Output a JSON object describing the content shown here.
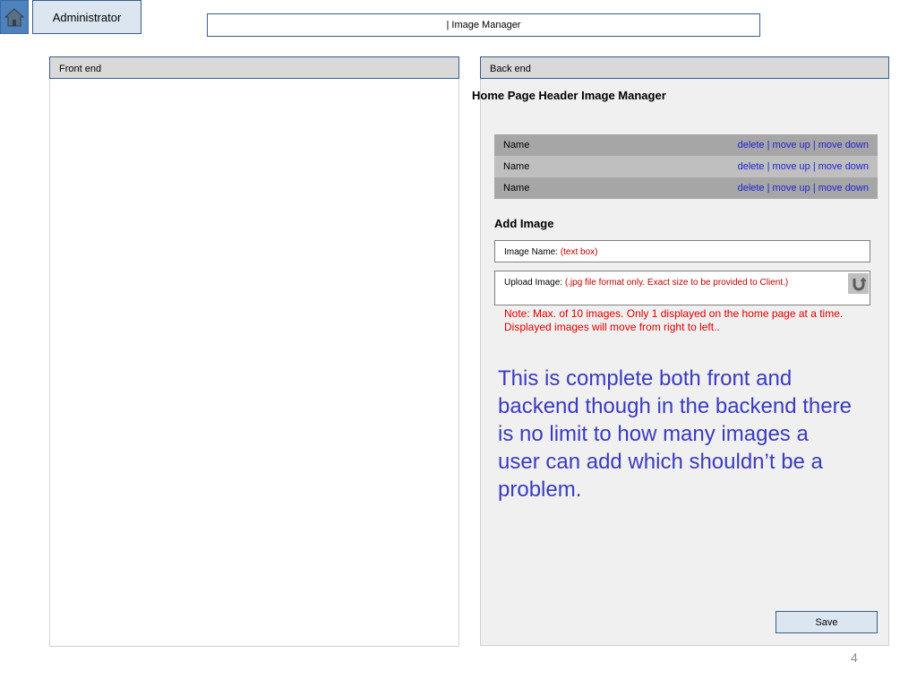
{
  "header": {
    "home_icon": "home-icon",
    "admin_label": "Administrator",
    "title": "| Image Manager"
  },
  "front_end": {
    "heading": "Front end"
  },
  "back_end": {
    "heading": "Back end",
    "section_title": "Home Page Header Image Manager",
    "images": [
      {
        "name": "Name",
        "delete": "delete",
        "move_up": "move up",
        "move_down": "move down"
      },
      {
        "name": "Name",
        "delete": "delete",
        "move_up": "move up",
        "move_down": "move down"
      },
      {
        "name": "Name",
        "delete": "delete",
        "move_up": "move up",
        "move_down": "move down"
      }
    ],
    "separator": "|",
    "add_title": "Add Image",
    "image_name_label": "Image Name:",
    "image_name_hint": "(text box)",
    "upload_label": "Upload Image:",
    "upload_hint": "(.jpg file format only. Exact size to be  provided to Client.)",
    "upload_icon": "upload-icon",
    "note": "Note: Max. of 10 images. Only 1 displayed on the home page at a time. Displayed images will move from right to left..",
    "comment": "This is complete both front and backend though in the backend there is no limit to how many images a user can add which shouldn’t be a problem.",
    "save_label": "Save"
  },
  "page_number": "4",
  "colors": {
    "accent": "#385d8a",
    "link": "#1f1fd6",
    "warning": "#c00000",
    "comment": "#3b3bbf"
  }
}
